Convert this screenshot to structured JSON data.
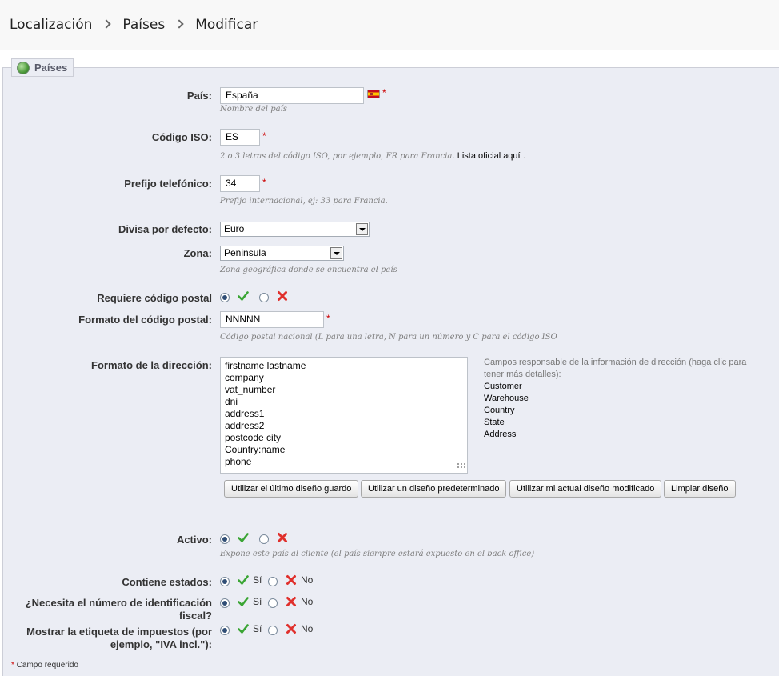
{
  "breadcrumb": [
    "Localización",
    "Países",
    "Modificar"
  ],
  "section": {
    "title": "Países"
  },
  "country": {
    "label": "País:",
    "value": "España",
    "hint": "Nombre del país"
  },
  "iso": {
    "label": "Código ISO:",
    "value": "ES",
    "hint": "2 o 3 letras del código ISO, por ejemplo, FR para Francia.",
    "hint_link": "Lista oficial aquí",
    "hint_end": "."
  },
  "phone": {
    "label": "Prefijo telefónico:",
    "value": "34",
    "hint": "Prefijo internacional, ej: 33 para Francia."
  },
  "currency": {
    "label": "Divisa por defecto:",
    "value": "Euro"
  },
  "zone": {
    "label": "Zona:",
    "value": "Peninsula",
    "hint": "Zona geográfica donde se encuentra el país"
  },
  "zip_required": {
    "label": "Requiere código postal",
    "selected": "yes"
  },
  "zip_format": {
    "label": "Formato del código postal:",
    "value": "NNNNN",
    "hint": "Código postal nacional (L para una letra, N para un número y C para el código ISO"
  },
  "address_format": {
    "label": "Formato de la dirección:",
    "lines": [
      "firstname lastname",
      "company",
      "vat_number",
      "dni",
      "address1",
      "address2",
      "postcode city",
      "Country:name",
      "phone"
    ],
    "note": "Campos responsable de la información de dirección (haga clic para tener más detalles):",
    "fields": [
      "Customer",
      "Warehouse",
      "Country",
      "State",
      "Address"
    ]
  },
  "buttons": {
    "last_saved": "Utilizar el último diseño guardo",
    "default": "Utilizar un diseño predeterminado",
    "current": "Utilizar mi actual diseño modificado",
    "clear": "Limpiar diseño"
  },
  "active": {
    "label": "Activo:",
    "hint": "Expone este país al cliente (el país siempre estará expuesto en el back office)",
    "selected": "yes"
  },
  "states": {
    "label": "Contiene estados:",
    "yes": "Sí",
    "no": "No",
    "selected": "yes"
  },
  "tax_id": {
    "label": "¿Necesita el número de identificación fiscal?",
    "yes": "Sí",
    "no": "No",
    "selected": "yes"
  },
  "tax_label": {
    "label": "Mostrar la etiqueta de impuestos (por ejemplo, \"IVA incl.\"):",
    "yes": "Sí",
    "no": "No",
    "selected": "yes"
  },
  "footer": {
    "star": "*",
    "text": "Campo requerido"
  },
  "required_mark": "*",
  "colors": {
    "accent_check": "#3aa534",
    "accent_cross": "#e0302c",
    "panel": "#ebedf4"
  }
}
